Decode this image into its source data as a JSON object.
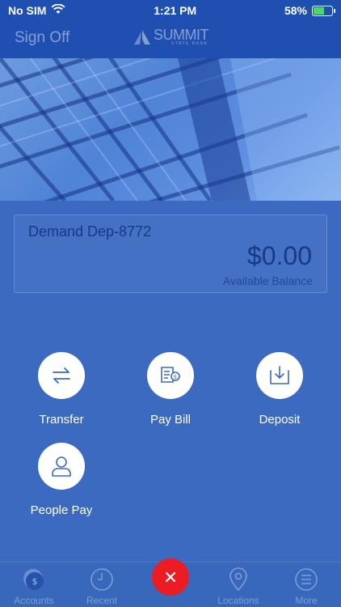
{
  "status_bar": {
    "carrier": "No SIM",
    "time": "1:21 PM",
    "battery_percent": "58%",
    "battery_level": 0.58
  },
  "nav": {
    "sign_off_label": "Sign Off",
    "logo_main": "SUMMIT",
    "logo_sub": "STATE BANK"
  },
  "account": {
    "name": "Demand Dep-8772",
    "balance": "$0.00",
    "balance_label": "Available Balance"
  },
  "actions": [
    {
      "label": "Transfer",
      "icon": "transfer-arrows-icon"
    },
    {
      "label": "Pay Bill",
      "icon": "bill-icon"
    },
    {
      "label": "Deposit",
      "icon": "deposit-tray-icon"
    },
    {
      "label": "People Pay",
      "icon": "person-icon"
    }
  ],
  "tabs": [
    {
      "label": "Accounts",
      "icon": "dollar-coin-icon"
    },
    {
      "label": "Recent",
      "icon": "clock-icon"
    },
    {
      "label": "Locations",
      "icon": "location-pin-icon"
    },
    {
      "label": "More",
      "icon": "menu-icon"
    }
  ],
  "colors": {
    "primary": "#3c6ac0",
    "header": "#1f4fb0",
    "close_button": "#ec1c24",
    "card_text": "#183a86"
  }
}
